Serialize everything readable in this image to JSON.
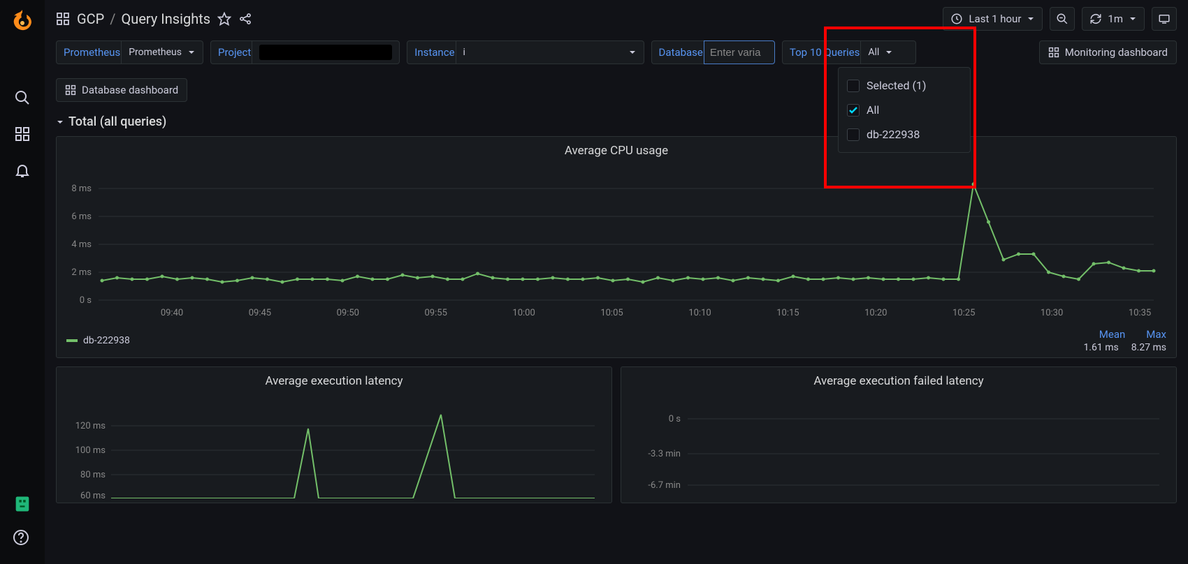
{
  "breadcrumb": {
    "folder": "GCP",
    "page": "Query Insights"
  },
  "timepicker": {
    "label": "Last 1 hour",
    "interval": "1m"
  },
  "vars": {
    "prometheus": {
      "label": "Prometheus",
      "value": "Prometheus"
    },
    "project": {
      "label": "Project",
      "value": ""
    },
    "instance": {
      "label": "Instance",
      "value": "i"
    },
    "database": {
      "label": "Database",
      "placeholder": "Enter varia"
    },
    "top10": {
      "label": "Top 10 Queries",
      "value": "All"
    }
  },
  "links": {
    "monitoring": "Monitoring dashboard",
    "database": "Database dashboard"
  },
  "dropdown": {
    "selected_label": "Selected (1)",
    "items": [
      {
        "label": "All",
        "checked": true
      },
      {
        "label": "db-222938",
        "checked": false
      }
    ]
  },
  "row": {
    "title": "Total (all queries)"
  },
  "panel1": {
    "title": "Average CPU usage",
    "y_ticks": [
      "8 ms",
      "6 ms",
      "4 ms",
      "2 ms",
      "0 s"
    ],
    "x_ticks": [
      "09:40",
      "09:45",
      "09:50",
      "09:55",
      "10:00",
      "10:05",
      "10:10",
      "10:15",
      "10:20",
      "10:25",
      "10:30",
      "10:35"
    ],
    "legend_series": "db-222938",
    "stat_headers": [
      "Mean",
      "Max"
    ],
    "stat_values": [
      "1.61 ms",
      "8.27 ms"
    ]
  },
  "panel2": {
    "title": "Average execution latency",
    "y_ticks": [
      "120 ms",
      "100 ms",
      "80 ms",
      "60 ms"
    ]
  },
  "panel3": {
    "title": "Average execution failed latency",
    "y_ticks": [
      "0 s",
      "-3.3 min",
      "-6.7 min"
    ]
  },
  "chart_data": [
    {
      "type": "line",
      "title": "Average CPU usage",
      "ylabel": "",
      "ylim": [
        0,
        8
      ],
      "y_unit": "ms",
      "x": [
        "09:40",
        "09:45",
        "09:50",
        "09:55",
        "10:00",
        "10:05",
        "10:10",
        "10:15",
        "10:20",
        "10:25",
        "10:30",
        "10:35"
      ],
      "series": [
        {
          "name": "db-222938",
          "color": "#73bf69",
          "values": [
            1.4,
            1.6,
            1.5,
            1.5,
            1.7,
            1.5,
            1.6,
            1.5,
            1.3,
            1.4,
            1.6,
            1.5,
            1.3,
            1.5,
            1.5,
            1.5,
            1.4,
            1.7,
            1.5,
            1.5,
            1.8,
            1.6,
            1.7,
            1.5,
            1.5,
            1.9,
            1.6,
            1.5,
            1.5,
            1.5,
            1.6,
            1.5,
            1.5,
            1.6,
            1.4,
            1.5,
            1.3,
            1.6,
            1.4,
            1.6,
            1.5,
            1.6,
            1.4,
            1.6,
            1.5,
            1.4,
            1.7,
            1.5,
            1.5,
            1.6,
            1.5,
            1.6,
            1.5,
            1.5,
            1.5,
            1.6,
            1.5,
            1.5,
            8.3,
            5.6,
            2.9,
            3.3,
            3.3,
            2.0,
            1.7,
            1.5,
            2.6,
            2.7,
            2.3,
            2.1,
            2.1
          ]
        }
      ]
    },
    {
      "type": "line",
      "title": "Average execution latency",
      "y_unit": "ms",
      "ylim": [
        60,
        130
      ],
      "x": [],
      "series": [
        {
          "name": "db-222938",
          "color": "#73bf69",
          "values_approx": "mostly ~60 ms baseline with two spikes to ~120 ms near 09:50 and 09:55"
        }
      ]
    },
    {
      "type": "line",
      "title": "Average execution failed latency",
      "y_unit": "min",
      "ylim": [
        -6.7,
        0
      ],
      "x": [],
      "series": []
    }
  ]
}
